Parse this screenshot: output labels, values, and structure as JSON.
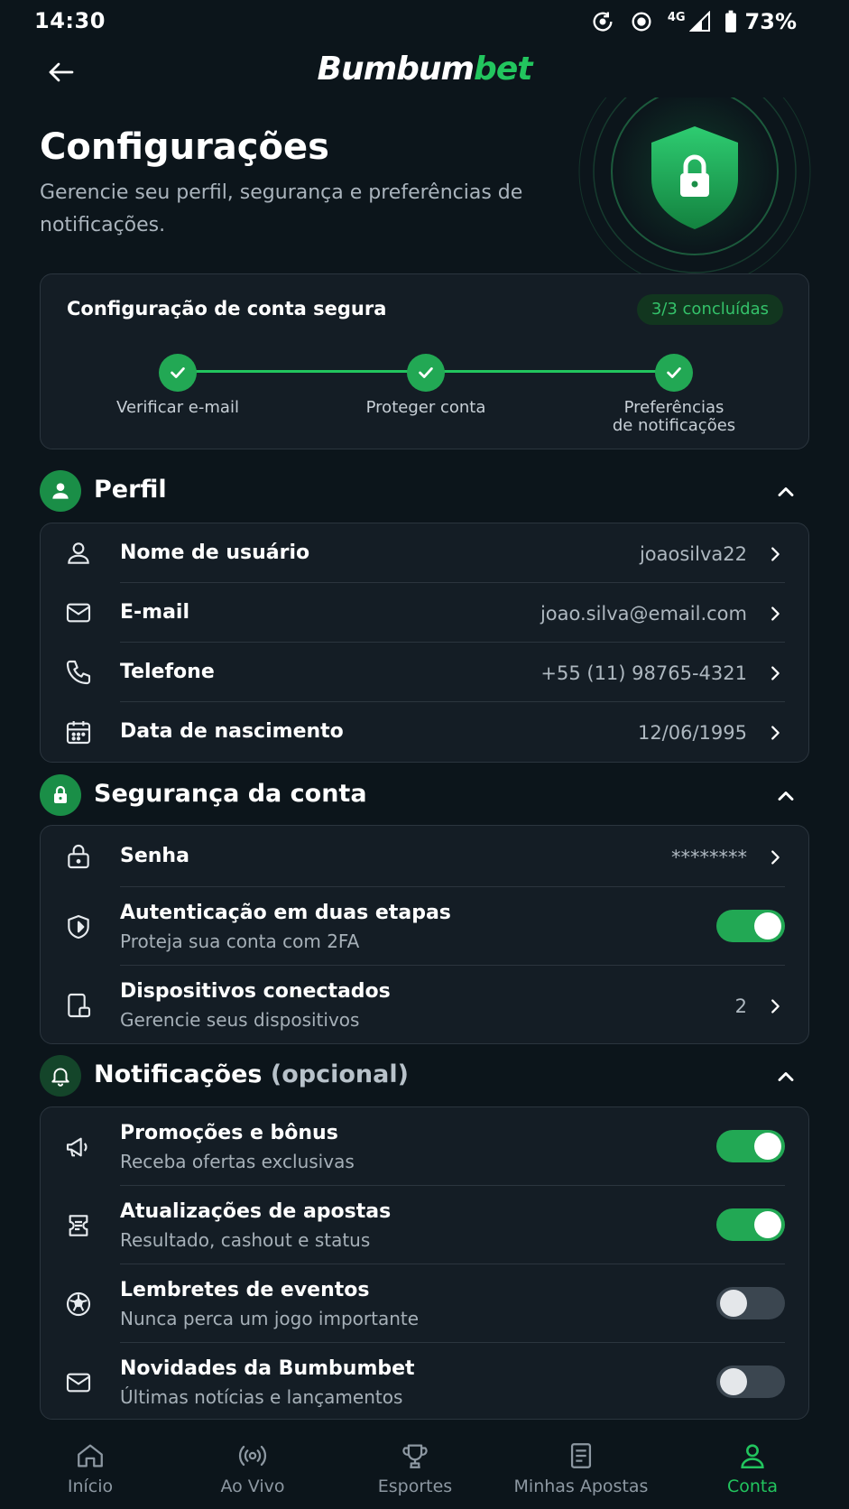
{
  "status_bar": {
    "time": "14:30",
    "network": "4G",
    "battery": "73%"
  },
  "app": {
    "logo_part1": "Bumbum",
    "logo_part2": "bet"
  },
  "header": {
    "title": "Configurações",
    "subtitle": "Gerencie seu perfil, segurança e preferências de notificações."
  },
  "progress": {
    "title": "Configuração de conta segura",
    "badge": "3/3 concluídas",
    "steps": [
      {
        "label": "Verificar e-mail"
      },
      {
        "label": "Proteger conta"
      },
      {
        "label_line1": "Preferências",
        "label_line2": "de notificações"
      }
    ]
  },
  "profile": {
    "title": "Perfil",
    "rows": [
      {
        "label": "Nome de usuário",
        "value": "joaosilva22",
        "icon": "user-icon"
      },
      {
        "label": "E-mail",
        "value": "joao.silva@email.com",
        "icon": "mail-icon"
      },
      {
        "label": "Telefone",
        "value": "+55 (11) 98765-4321",
        "icon": "phone-icon"
      },
      {
        "label": "Data de nascimento",
        "value": "12/06/1995",
        "icon": "calendar-icon"
      }
    ]
  },
  "security": {
    "title": "Segurança da conta",
    "password": {
      "label": "Senha",
      "value": "********"
    },
    "two_factor": {
      "label": "Autenticação em duas etapas",
      "sub": "Proteja sua conta com 2FA",
      "enabled": true
    },
    "devices": {
      "label": "Dispositivos conectados",
      "sub": "Gerencie seus dispositivos",
      "value": "2"
    }
  },
  "notifications": {
    "title": "Notificações",
    "title_suffix": "(opcional)",
    "rows": [
      {
        "label": "Promoções e bônus",
        "sub": "Receba ofertas exclusivas",
        "enabled": true,
        "icon": "megaphone-icon"
      },
      {
        "label": "Atualizações de apostas",
        "sub": "Resultado, cashout e status",
        "enabled": true,
        "icon": "ticket-icon"
      },
      {
        "label": "Lembretes de eventos",
        "sub": "Nunca perca um jogo importante",
        "enabled": false,
        "icon": "soccer-ball-icon"
      },
      {
        "label": "Novidades da Bumbumbet",
        "sub": "Últimas notícias e lançamentos",
        "enabled": false,
        "icon": "mail-icon"
      }
    ]
  },
  "bottom_nav": {
    "items": [
      {
        "label": "Início",
        "icon": "home-icon"
      },
      {
        "label": "Ao Vivo",
        "icon": "live-icon"
      },
      {
        "label": "Esportes",
        "icon": "trophy-icon"
      },
      {
        "label": "Minhas Apostas",
        "icon": "receipt-icon"
      },
      {
        "label": "Conta",
        "icon": "user-icon",
        "active": true
      }
    ]
  },
  "colors": {
    "accent": "#22c55e",
    "background": "#0c151b",
    "card": "#141d25"
  }
}
